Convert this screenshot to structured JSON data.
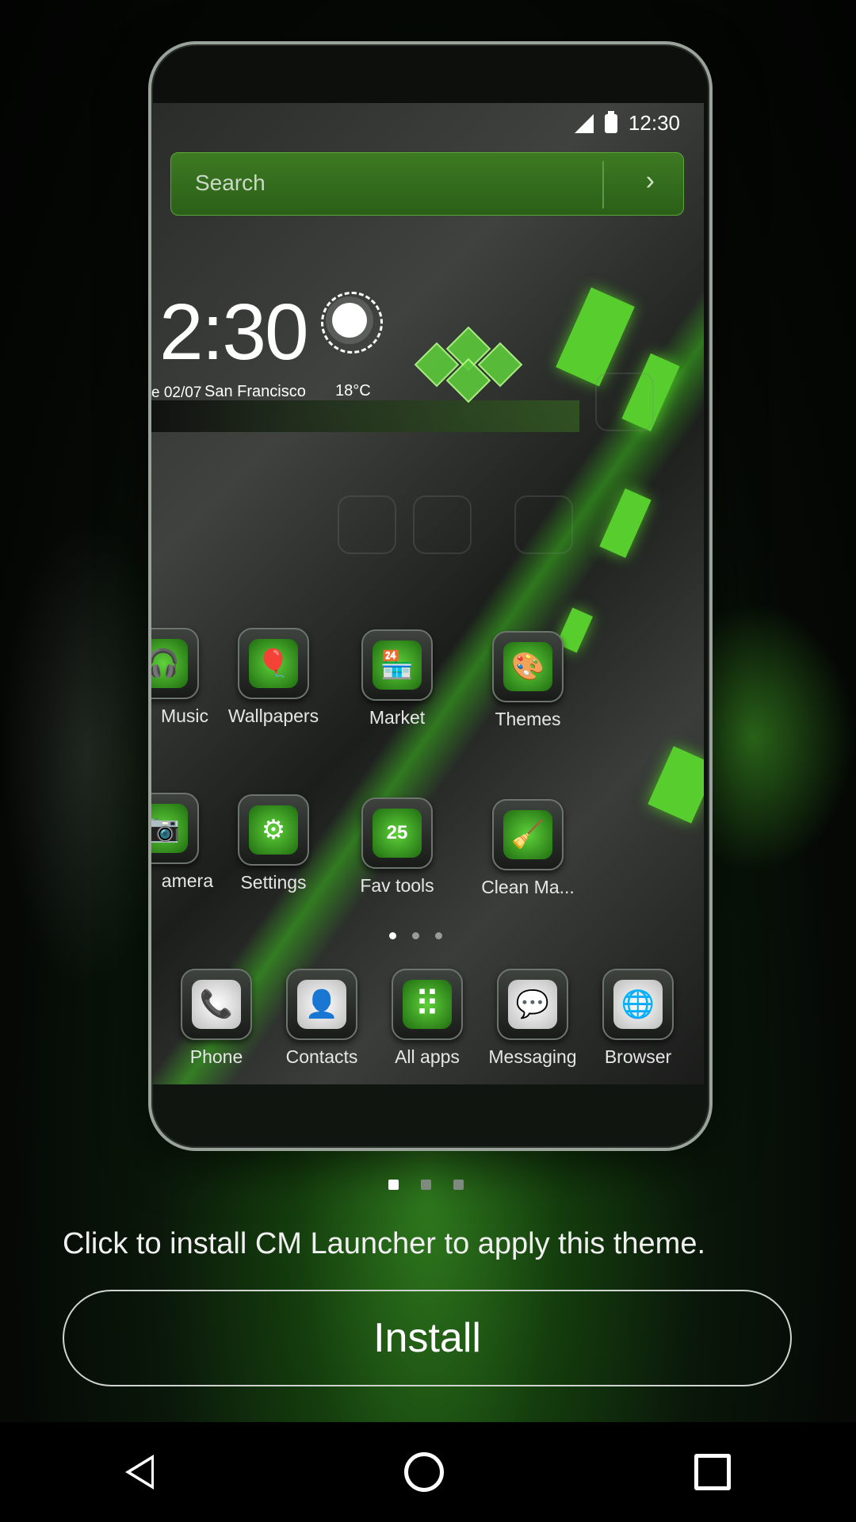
{
  "status_bar": {
    "time": "12:30"
  },
  "search": {
    "placeholder": "Search",
    "arrow": "›"
  },
  "widget": {
    "time": "2:30",
    "date": "e 02/07",
    "city": "San Francisco",
    "temp": "18°C"
  },
  "grid": {
    "row1": [
      {
        "label": "Music",
        "icon": "headphones-icon",
        "glyph": "🎧"
      },
      {
        "label": "Wallpapers",
        "icon": "balloon-icon",
        "glyph": "🎈"
      },
      {
        "label": "Market",
        "icon": "store-icon",
        "glyph": "🏪"
      },
      {
        "label": "Themes",
        "icon": "palette-icon",
        "glyph": "🎨"
      }
    ],
    "row2": [
      {
        "label": "amera",
        "icon": "camera-icon",
        "glyph": "📷"
      },
      {
        "label": "Settings",
        "icon": "gear-icon",
        "glyph": "⚙"
      },
      {
        "label": "Fav tools",
        "icon": "tools-icon",
        "glyph": "25"
      },
      {
        "label": "Clean Ma...",
        "icon": "broom-icon",
        "glyph": "🧹"
      }
    ]
  },
  "dock": [
    {
      "label": "Phone",
      "icon": "phone-icon",
      "glyph": "📞"
    },
    {
      "label": "Contacts",
      "icon": "contact-icon",
      "glyph": "👤"
    },
    {
      "label": "All apps",
      "icon": "apps-grid-icon",
      "glyph": "⠿"
    },
    {
      "label": "Messaging",
      "icon": "message-icon",
      "glyph": "💬"
    },
    {
      "label": "Browser",
      "icon": "globe-icon",
      "glyph": "🌐"
    }
  ],
  "hint": "Click to install CM Launcher to apply this theme.",
  "install_button": "Install",
  "pager": {
    "pages": 3,
    "active": 1
  }
}
